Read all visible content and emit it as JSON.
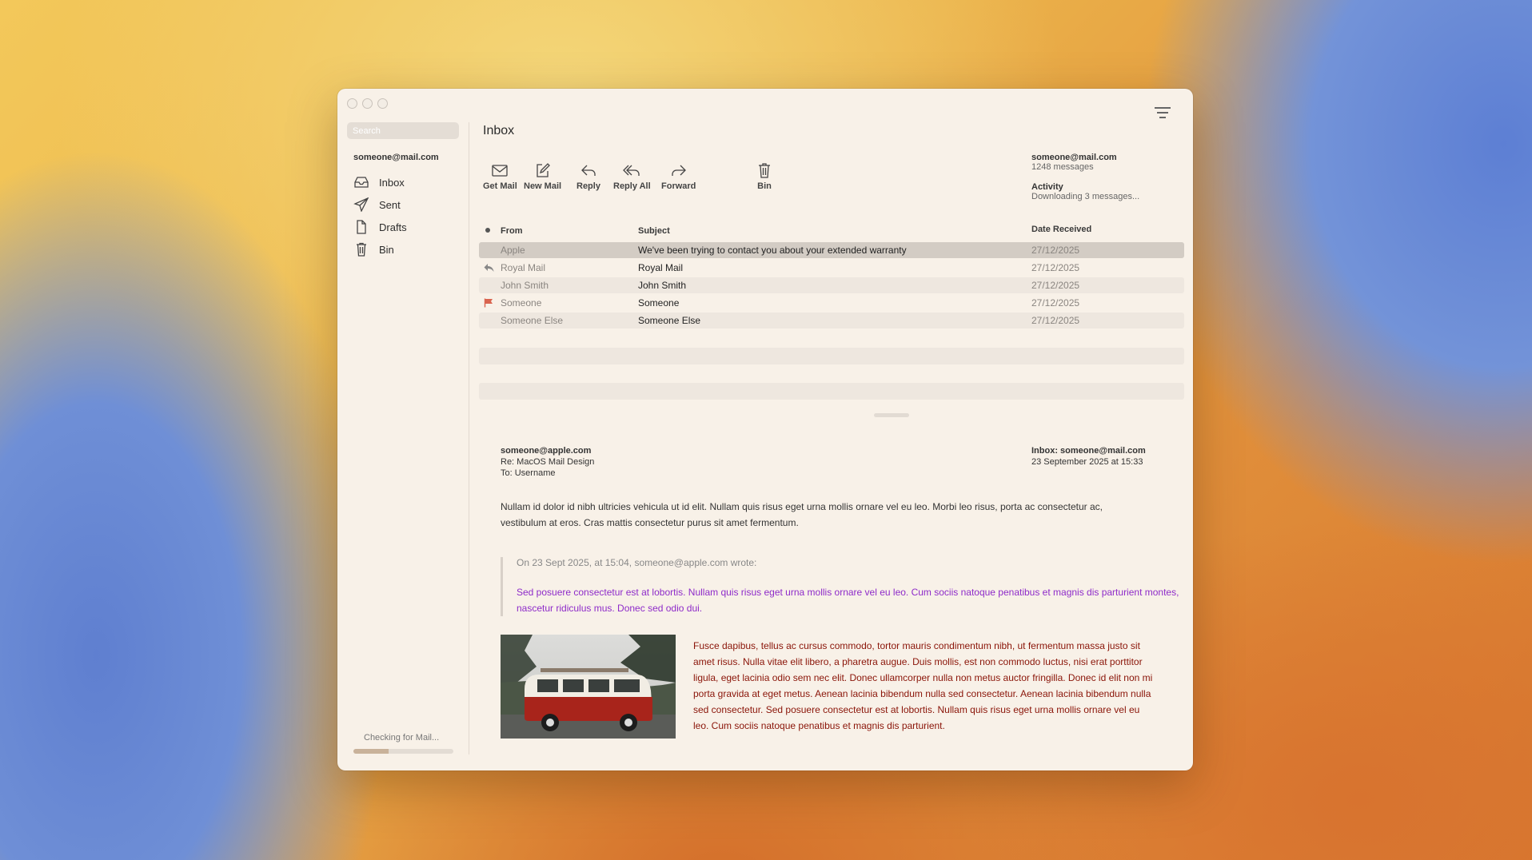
{
  "sidebar": {
    "search_placeholder": "Search",
    "account": "someone@mail.com",
    "items": [
      {
        "label": "Inbox",
        "icon": "inbox-icon"
      },
      {
        "label": "Sent",
        "icon": "paper-plane-icon"
      },
      {
        "label": "Drafts",
        "icon": "document-icon"
      },
      {
        "label": "Bin",
        "icon": "trash-icon"
      }
    ],
    "status": "Checking for Mail...",
    "progress": 0.35
  },
  "main": {
    "title": "Inbox",
    "toolbar": {
      "get_mail": "Get Mail",
      "new_mail": "New Mail",
      "reply": "Reply",
      "reply_all": "Reply All",
      "forward": "Forward",
      "bin": "Bin"
    },
    "account_info": {
      "email": "someone@mail.com",
      "count": "1248 messages",
      "activity_label": "Activity",
      "activity_status": "Downloading 3 messages..."
    },
    "columns": {
      "from": "From",
      "subject": "Subject",
      "date": "Date Received"
    },
    "messages": [
      {
        "from": "Apple",
        "subject": "We've been trying to contact you about your extended warranty",
        "date": "27/12/2025",
        "status_icon": "",
        "selected": true
      },
      {
        "from": "Royal Mail",
        "subject": "Royal Mail",
        "date": "27/12/2025",
        "status_icon": "replied-arrow-icon"
      },
      {
        "from": "John Smith",
        "subject": "John Smith",
        "date": "27/12/2025",
        "status_icon": ""
      },
      {
        "from": "Someone",
        "subject": "Someone",
        "date": "27/12/2025",
        "status_icon": "flag-icon"
      },
      {
        "from": "Someone Else",
        "subject": "Someone Else",
        "date": "27/12/2025",
        "status_icon": ""
      }
    ]
  },
  "preview": {
    "from": "someone@apple.com",
    "subject": "Re: MacOS Mail Design",
    "to": "To: Username",
    "mailbox": "Inbox: someone@mail.com",
    "date": "23 September 2025 at 15:33",
    "body": "Nullam id dolor id nibh ultricies vehicula ut id elit. Nullam quis risus eget urna mollis ornare vel eu leo. Morbi leo risus, porta ac consectetur ac, vestibulum at eros. Cras mattis consectetur purus sit amet fermentum.",
    "quote_header": "On 23 Sept 2025, at 15:04, someone@apple.com wrote:",
    "quote_body": "Sed posuere consectetur est at lobortis. Nullam quis risus eget urna mollis ornare vel eu leo. Cum sociis natoque penatibus et magnis dis parturient montes, nascetur ridiculus mus. Donec sed odio dui.",
    "quote_text": "Fusce dapibus, tellus ac cursus commodo, tortor mauris condimentum nibh, ut fermentum massa justo sit amet risus. Nulla vitae elit libero, a pharetra  augue. Duis mollis, est non commodo luctus, nisi erat porttitor ligula, eget lacinia odio sem nec elit. Donec ullamcorper nulla non metus auctor fringilla.  Donec id elit non mi porta gravida at eget metus. Aenean lacinia bibendum nulla sed consectetur. Aenean lacinia bibendum nulla sed consectetur. Sed posuere consectetur est at lobortis. Nullam quis risus eget urna mollis ornare vel eu leo. Cum sociis natoque penatibus et magnis dis parturient.",
    "colors": {
      "quote": "#8e2bc9",
      "text": "#8a1408"
    }
  }
}
